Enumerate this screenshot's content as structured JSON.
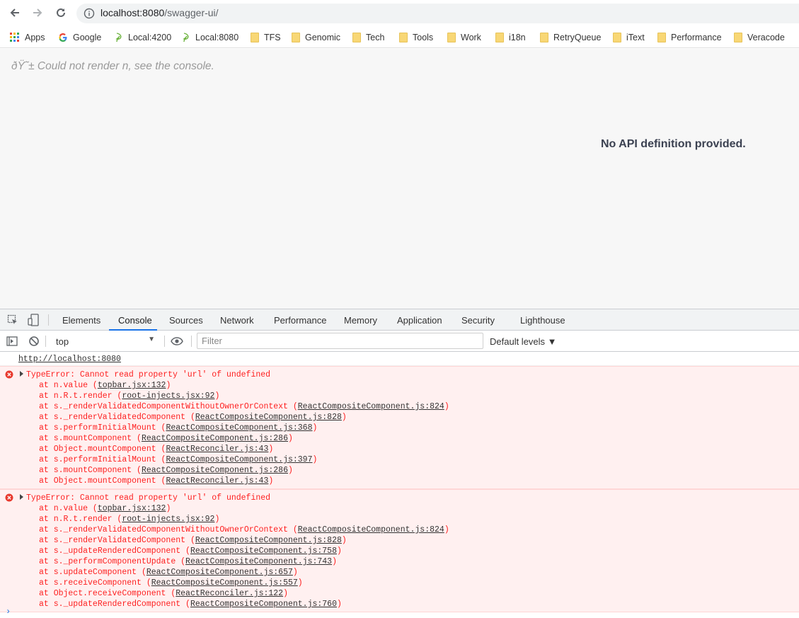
{
  "browser": {
    "url_host": "localhost:8080",
    "url_path": "/swagger-ui/"
  },
  "bookmarks": [
    {
      "label": "Apps",
      "icon": "apps-grid-icon"
    },
    {
      "label": "Google",
      "icon": "google-icon"
    },
    {
      "label": "Local:4200",
      "icon": "leaf-icon"
    },
    {
      "label": "Local:8080",
      "icon": "leaf-icon"
    },
    {
      "label": "TFS",
      "icon": "folder-icon"
    },
    {
      "label": "Genomic",
      "icon": "folder-icon"
    },
    {
      "label": "Tech",
      "icon": "folder-icon"
    },
    {
      "label": "Tools",
      "icon": "folder-icon"
    },
    {
      "label": "Work",
      "icon": "folder-icon"
    },
    {
      "label": "i18n",
      "icon": "folder-icon"
    },
    {
      "label": "RetryQueue",
      "icon": "folder-icon"
    },
    {
      "label": "iText",
      "icon": "folder-icon"
    },
    {
      "label": "Performance",
      "icon": "folder-icon"
    },
    {
      "label": "Veracode",
      "icon": "folder-icon"
    }
  ],
  "page": {
    "error_text": "ðŸ˜± Could not render n, see the console.",
    "no_api_text": "No API definition provided."
  },
  "devtools": {
    "tabs": [
      "Elements",
      "Console",
      "Sources",
      "Network",
      "Performance",
      "Memory",
      "Application",
      "Security",
      "Lighthouse"
    ],
    "active_tab": "Console",
    "context": "top",
    "filter_placeholder": "Filter",
    "levels": "Default levels ▼",
    "source_link": "http://localhost:8080",
    "errors": [
      {
        "message": "TypeError: Cannot read property 'url' of undefined",
        "frames": [
          {
            "fn": "at n.value ",
            "file": "topbar.jsx:132"
          },
          {
            "fn": "at n.R.t.render ",
            "file": "root-injects.jsx:92"
          },
          {
            "fn": "at s._renderValidatedComponentWithoutOwnerOrContext ",
            "file": "ReactCompositeComponent.js:824"
          },
          {
            "fn": "at s._renderValidatedComponent ",
            "file": "ReactCompositeComponent.js:828"
          },
          {
            "fn": "at s.performInitialMount ",
            "file": "ReactCompositeComponent.js:368"
          },
          {
            "fn": "at s.mountComponent ",
            "file": "ReactCompositeComponent.js:286"
          },
          {
            "fn": "at Object.mountComponent ",
            "file": "ReactReconciler.js:43"
          },
          {
            "fn": "at s.performInitialMount ",
            "file": "ReactCompositeComponent.js:397"
          },
          {
            "fn": "at s.mountComponent ",
            "file": "ReactCompositeComponent.js:286"
          },
          {
            "fn": "at Object.mountComponent ",
            "file": "ReactReconciler.js:43"
          }
        ]
      },
      {
        "message": "TypeError: Cannot read property 'url' of undefined",
        "frames": [
          {
            "fn": "at n.value ",
            "file": "topbar.jsx:132"
          },
          {
            "fn": "at n.R.t.render ",
            "file": "root-injects.jsx:92"
          },
          {
            "fn": "at s._renderValidatedComponentWithoutOwnerOrContext ",
            "file": "ReactCompositeComponent.js:824"
          },
          {
            "fn": "at s._renderValidatedComponent ",
            "file": "ReactCompositeComponent.js:828"
          },
          {
            "fn": "at s._updateRenderedComponent ",
            "file": "ReactCompositeComponent.js:758"
          },
          {
            "fn": "at s._performComponentUpdate ",
            "file": "ReactCompositeComponent.js:743"
          },
          {
            "fn": "at s.updateComponent ",
            "file": "ReactCompositeComponent.js:657"
          },
          {
            "fn": "at s.receiveComponent ",
            "file": "ReactCompositeComponent.js:557"
          },
          {
            "fn": "at Object.receiveComponent ",
            "file": "ReactReconciler.js:122"
          },
          {
            "fn": "at s._updateRenderedComponent ",
            "file": "ReactCompositeComponent.js:760"
          }
        ]
      }
    ]
  }
}
